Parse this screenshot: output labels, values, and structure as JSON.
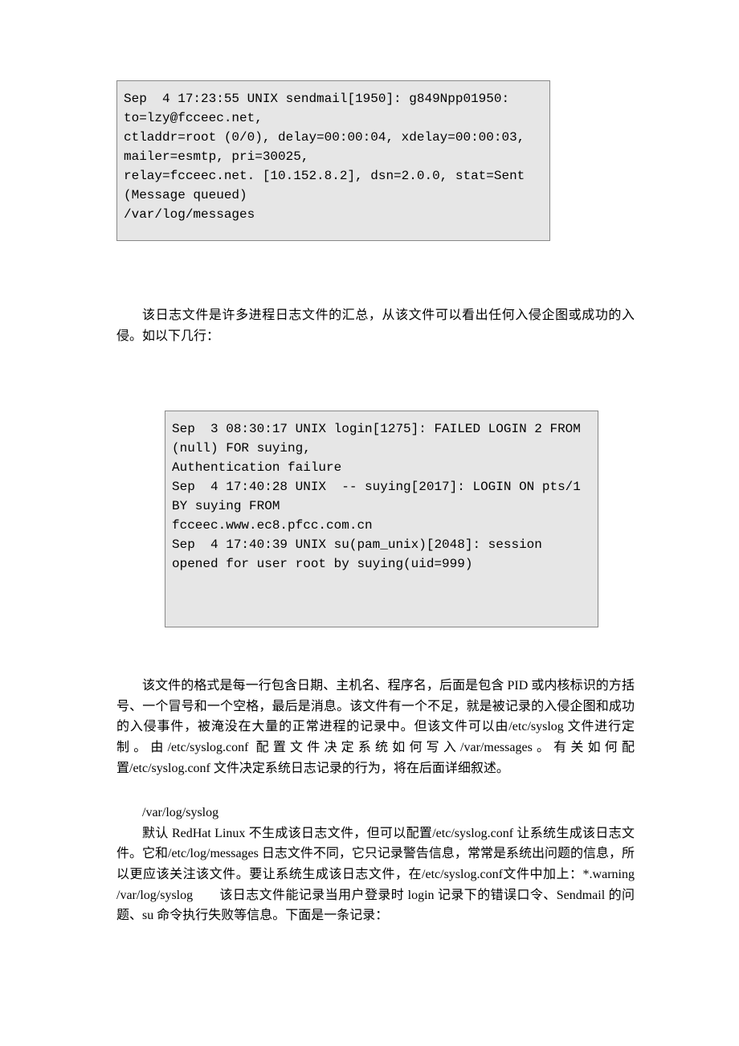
{
  "code1": "Sep  4 17:23:55 UNIX sendmail[1950]: g849Npp01950: to=lzy@fcceec.net,\nctladdr=root (0/0), delay=00:00:04, xdelay=00:00:03, mailer=esmtp, pri=30025,\nrelay=fcceec.net. [10.152.8.2], dsn=2.0.0, stat=Sent (Message queued)\n/var/log/messages",
  "para1": "该日志文件是许多进程日志文件的汇总，从该文件可以看出任何入侵企图或成功的入侵。如以下几行：",
  "code2": "Sep  3 08:30:17 UNIX login[1275]: FAILED LOGIN 2 FROM (null) FOR suying,\nAuthentication failure\nSep  4 17:40:28 UNIX  -- suying[2017]: LOGIN ON pts/1 BY suying FROM\nfcceec.www.ec8.pfcc.com.cn\nSep  4 17:40:39 UNIX su(pam_unix)[2048]: session opened for user root by suying(uid=999)",
  "para2": "该文件的格式是每一行包含日期、主机名、程序名，后面是包含 PID 或内核标识的方括号、一个冒号和一个空格，最后是消息。该文件有一个不足，就是被记录的入侵企图和成功的入侵事件，被淹没在大量的正常进程的记录中。但该文件可以由/etc/syslog 文件进行定制。由/etc/syslog.conf 配置文件决定系统如何写入/var/messages。有关如何配置/etc/syslog.conf 文件决定系统日志记录的行为，将在后面详细叙述。",
  "heading": "/var/log/syslog",
  "para3": "默认 RedHat Linux 不生成该日志文件，但可以配置/etc/syslog.conf 让系统生成该日志文件。它和/etc/log/messages 日志文件不同，它只记录警告信息，常常是系统出问题的信息，所以更应该关注该文件。要让系统生成该日志文件，在/etc/syslog.conf文件中加上：*.warning /var/log/syslog　　该日志文件能记录当用户登录时 login 记录下的错误口令、Sendmail 的问题、su 命令执行失败等信息。下面是一条记录："
}
